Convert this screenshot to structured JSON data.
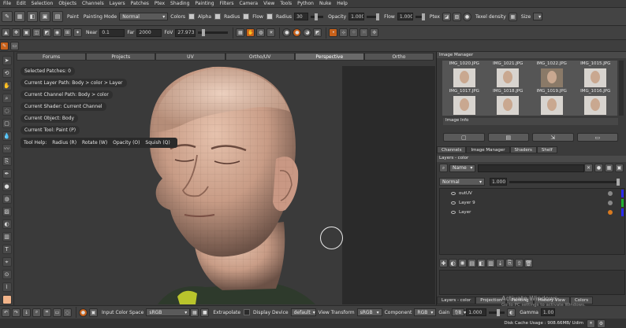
{
  "menu": [
    "File",
    "Edit",
    "Selection",
    "Objects",
    "Channels",
    "Layers",
    "Patches",
    "Ptex",
    "Shading",
    "Painting",
    "Filters",
    "Camera",
    "View",
    "Tools",
    "Python",
    "Nuke",
    "Help"
  ],
  "toolbar1": {
    "paint_label": "Paint",
    "painting_mode_label": "Painting Mode",
    "painting_mode_value": "Normal",
    "colors_label": "Colors",
    "alpha_label": "Alpha",
    "radius_label": "Radius",
    "flow_label": "Flow",
    "radius2_label": "Radius",
    "radius_value": "30",
    "opacity_label": "Opacity",
    "opacity_value": "1.000",
    "flow2_label": "Flow",
    "flow_value": "1.000",
    "ptex_label": "Ptex",
    "texel_label": "Texel density",
    "size_label": "Size"
  },
  "toolbar2": {
    "near_label": "Near",
    "near_value": "0.1",
    "far_label": "Far",
    "far_value": "2000",
    "fov_label": "FoV",
    "fov_value": "27.973"
  },
  "tabs": [
    "Forums",
    "Projects",
    "UV",
    "Ortho/UV",
    "Perspective",
    "Ortho"
  ],
  "active_tab": "Perspective",
  "hud": {
    "selected_patches": "Selected Patches: 0",
    "layer_path": "Current Layer Path: Body > color > Layer",
    "channel_path": "Current Channel Path: Body > color",
    "shader": "Current Shader: Current Channel",
    "object": "Current Object: Body",
    "tool": "Current Tool: Paint (P)",
    "toolhelp": [
      "Tool Help:",
      "Radius (R)",
      "Rotate (W)",
      "Opacity (O)",
      "Squish (Q)"
    ]
  },
  "image_manager": {
    "title": "Image Manager",
    "row1": [
      "IMG_1020.JPG",
      "IMG_1021.JPG",
      "IMG_1022.JPG",
      "IMG_1015.JPG"
    ],
    "row2": [
      "IMG_1017.JPG",
      "IMG_1018.JPG",
      "IMG_1019.JPG",
      "IMG_1016.JPG"
    ],
    "image_info": "Image Info"
  },
  "panel_tabs": [
    "Channels",
    "Image Manager",
    "Shaders",
    "Shelf"
  ],
  "active_panel_tab": "Image Manager",
  "layers": {
    "title": "Layers - color",
    "filter_label": "Name",
    "blend_value": "Normal",
    "opacity_value": "1.000",
    "items": [
      "outUV",
      "Layer 9",
      "Layer"
    ]
  },
  "bottom_tabs": [
    "Layers - color",
    "Projection",
    "Painting",
    "History View",
    "Colors"
  ],
  "bottombar": {
    "input_cs_label": "Input Color Space",
    "input_cs_value": "sRGB",
    "extrapolate_label": "Extrapolate",
    "display_device_label": "Display Device",
    "display_device_value": "default",
    "view_transform_label": "View Transform",
    "view_transform_value": "sRGB",
    "component_label": "Component",
    "component_value": "RGB",
    "gain_label": "Gain",
    "gain_value": "f/8",
    "gain_num": "1.000",
    "gamma_label": "Gamma",
    "gamma_value": "1.00"
  },
  "status": {
    "disk_cache": "Disk Cache Usage : 908.66MB/ Udim"
  },
  "watermark": {
    "line1": "Activate Windows",
    "line2": "Go to PC settings to activate Windows."
  },
  "colors": {
    "accent_orange": "#c8611a",
    "panel_bg": "#3b3b3b"
  }
}
